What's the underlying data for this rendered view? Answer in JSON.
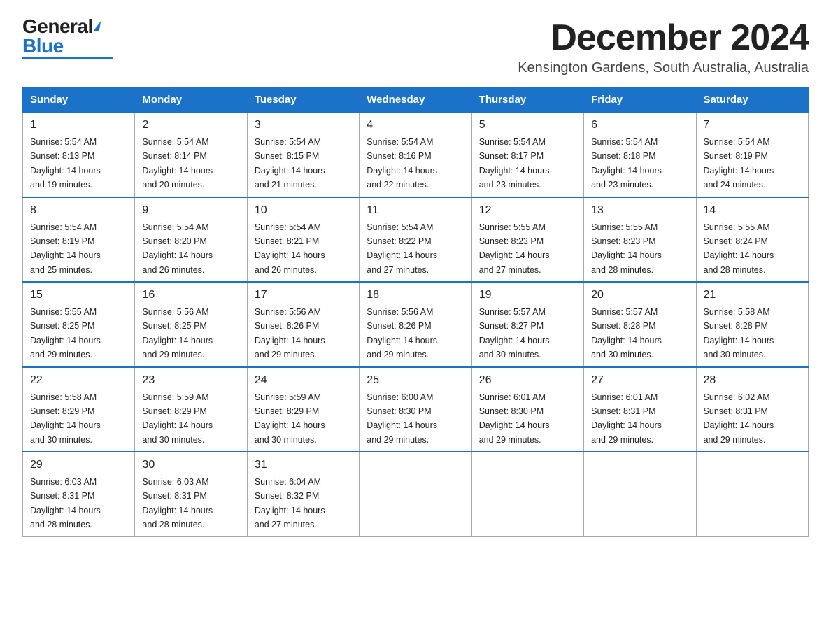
{
  "logo": {
    "general": "General",
    "blue": "Blue",
    "tagline": ""
  },
  "title": "December 2024",
  "subtitle": "Kensington Gardens, South Australia, Australia",
  "weekdays": [
    "Sunday",
    "Monday",
    "Tuesday",
    "Wednesday",
    "Thursday",
    "Friday",
    "Saturday"
  ],
  "weeks": [
    [
      {
        "day": "1",
        "sunrise": "5:54 AM",
        "sunset": "8:13 PM",
        "daylight": "14 hours and 19 minutes."
      },
      {
        "day": "2",
        "sunrise": "5:54 AM",
        "sunset": "8:14 PM",
        "daylight": "14 hours and 20 minutes."
      },
      {
        "day": "3",
        "sunrise": "5:54 AM",
        "sunset": "8:15 PM",
        "daylight": "14 hours and 21 minutes."
      },
      {
        "day": "4",
        "sunrise": "5:54 AM",
        "sunset": "8:16 PM",
        "daylight": "14 hours and 22 minutes."
      },
      {
        "day": "5",
        "sunrise": "5:54 AM",
        "sunset": "8:17 PM",
        "daylight": "14 hours and 23 minutes."
      },
      {
        "day": "6",
        "sunrise": "5:54 AM",
        "sunset": "8:18 PM",
        "daylight": "14 hours and 23 minutes."
      },
      {
        "day": "7",
        "sunrise": "5:54 AM",
        "sunset": "8:19 PM",
        "daylight": "14 hours and 24 minutes."
      }
    ],
    [
      {
        "day": "8",
        "sunrise": "5:54 AM",
        "sunset": "8:19 PM",
        "daylight": "14 hours and 25 minutes."
      },
      {
        "day": "9",
        "sunrise": "5:54 AM",
        "sunset": "8:20 PM",
        "daylight": "14 hours and 26 minutes."
      },
      {
        "day": "10",
        "sunrise": "5:54 AM",
        "sunset": "8:21 PM",
        "daylight": "14 hours and 26 minutes."
      },
      {
        "day": "11",
        "sunrise": "5:54 AM",
        "sunset": "8:22 PM",
        "daylight": "14 hours and 27 minutes."
      },
      {
        "day": "12",
        "sunrise": "5:55 AM",
        "sunset": "8:23 PM",
        "daylight": "14 hours and 27 minutes."
      },
      {
        "day": "13",
        "sunrise": "5:55 AM",
        "sunset": "8:23 PM",
        "daylight": "14 hours and 28 minutes."
      },
      {
        "day": "14",
        "sunrise": "5:55 AM",
        "sunset": "8:24 PM",
        "daylight": "14 hours and 28 minutes."
      }
    ],
    [
      {
        "day": "15",
        "sunrise": "5:55 AM",
        "sunset": "8:25 PM",
        "daylight": "14 hours and 29 minutes."
      },
      {
        "day": "16",
        "sunrise": "5:56 AM",
        "sunset": "8:25 PM",
        "daylight": "14 hours and 29 minutes."
      },
      {
        "day": "17",
        "sunrise": "5:56 AM",
        "sunset": "8:26 PM",
        "daylight": "14 hours and 29 minutes."
      },
      {
        "day": "18",
        "sunrise": "5:56 AM",
        "sunset": "8:26 PM",
        "daylight": "14 hours and 29 minutes."
      },
      {
        "day": "19",
        "sunrise": "5:57 AM",
        "sunset": "8:27 PM",
        "daylight": "14 hours and 30 minutes."
      },
      {
        "day": "20",
        "sunrise": "5:57 AM",
        "sunset": "8:28 PM",
        "daylight": "14 hours and 30 minutes."
      },
      {
        "day": "21",
        "sunrise": "5:58 AM",
        "sunset": "8:28 PM",
        "daylight": "14 hours and 30 minutes."
      }
    ],
    [
      {
        "day": "22",
        "sunrise": "5:58 AM",
        "sunset": "8:29 PM",
        "daylight": "14 hours and 30 minutes."
      },
      {
        "day": "23",
        "sunrise": "5:59 AM",
        "sunset": "8:29 PM",
        "daylight": "14 hours and 30 minutes."
      },
      {
        "day": "24",
        "sunrise": "5:59 AM",
        "sunset": "8:29 PM",
        "daylight": "14 hours and 30 minutes."
      },
      {
        "day": "25",
        "sunrise": "6:00 AM",
        "sunset": "8:30 PM",
        "daylight": "14 hours and 29 minutes."
      },
      {
        "day": "26",
        "sunrise": "6:01 AM",
        "sunset": "8:30 PM",
        "daylight": "14 hours and 29 minutes."
      },
      {
        "day": "27",
        "sunrise": "6:01 AM",
        "sunset": "8:31 PM",
        "daylight": "14 hours and 29 minutes."
      },
      {
        "day": "28",
        "sunrise": "6:02 AM",
        "sunset": "8:31 PM",
        "daylight": "14 hours and 29 minutes."
      }
    ],
    [
      {
        "day": "29",
        "sunrise": "6:03 AM",
        "sunset": "8:31 PM",
        "daylight": "14 hours and 28 minutes."
      },
      {
        "day": "30",
        "sunrise": "6:03 AM",
        "sunset": "8:31 PM",
        "daylight": "14 hours and 28 minutes."
      },
      {
        "day": "31",
        "sunrise": "6:04 AM",
        "sunset": "8:32 PM",
        "daylight": "14 hours and 27 minutes."
      },
      null,
      null,
      null,
      null
    ]
  ],
  "labels": {
    "sunrise": "Sunrise:",
    "sunset": "Sunset:",
    "daylight": "Daylight:"
  }
}
